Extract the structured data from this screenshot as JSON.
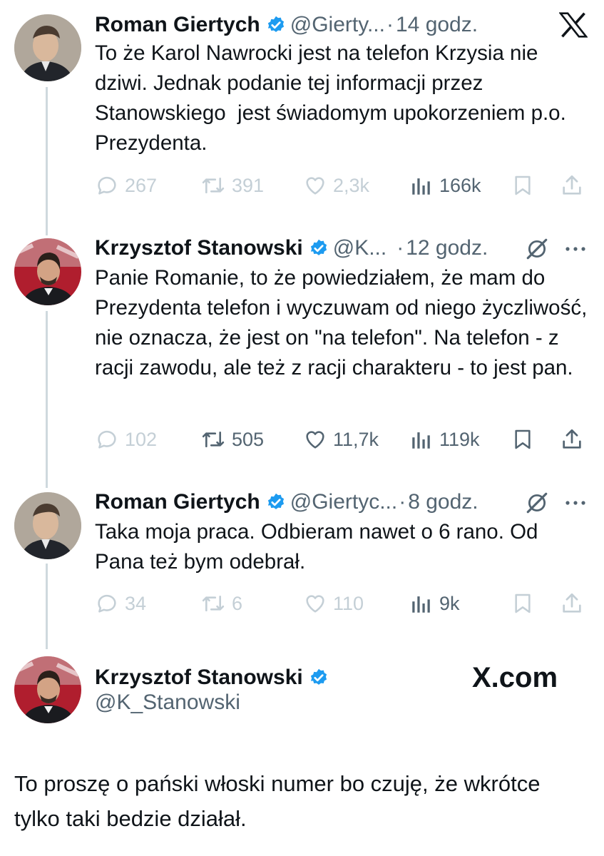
{
  "tweets": [
    {
      "name": "Roman Giertych",
      "handle": "@Gierty...",
      "time": "14 godz.",
      "text": "To że Karol Nawrocki jest na telefon Krzysia nie dziwi. Jednak podanie tej informacji przez Stanowskiego  jest świadomym upokorzeniem p.o. Prezydenta.",
      "replies": "267",
      "retweets": "391",
      "likes": "2,3k",
      "views": "166k"
    },
    {
      "name": "Krzysztof Stanowski",
      "handle": "@K...",
      "time": "12 godz.",
      "text": "Panie Romanie, to że powiedziałem, że mam do Prezydenta telefon i wyczuwam od niego życzliwość, nie oznacza, że jest on \"na telefon\". Na telefon - z racji zawodu, ale też z racji charakteru - to jest pan.",
      "replies": "102",
      "retweets": "505",
      "likes": "11,7k",
      "views": "119k"
    },
    {
      "name": "Roman Giertych",
      "handle": "@Giertyc...",
      "time": "8 godz.",
      "text": "Taka moja praca. Odbieram nawet o 6 rano. Od Pana też bym odebrał.",
      "replies": "34",
      "retweets": "6",
      "likes": "110",
      "views": "9k"
    }
  ],
  "final": {
    "name": "Krzysztof Stanowski",
    "handle": "@K_Stanowski",
    "text": "To proszę o pański włoski numer bo czuję, że wkrótce tylko taki bedzie działał."
  },
  "watermark": "X.com",
  "separator": "·",
  "icons": {
    "verified": "verified-badge-icon",
    "logo": "x-logo-icon",
    "grok": "grok-icon",
    "more": "more-icon",
    "reply": "reply-icon",
    "retweet": "retweet-icon",
    "like": "heart-icon",
    "views": "views-icon",
    "bookmark": "bookmark-icon",
    "share": "share-icon"
  },
  "colors": {
    "verified": "#1d9bf0",
    "text": "#0f1419",
    "muted": "#536471",
    "faded": "#c4cfd6",
    "thread_line": "#cfd9de"
  }
}
